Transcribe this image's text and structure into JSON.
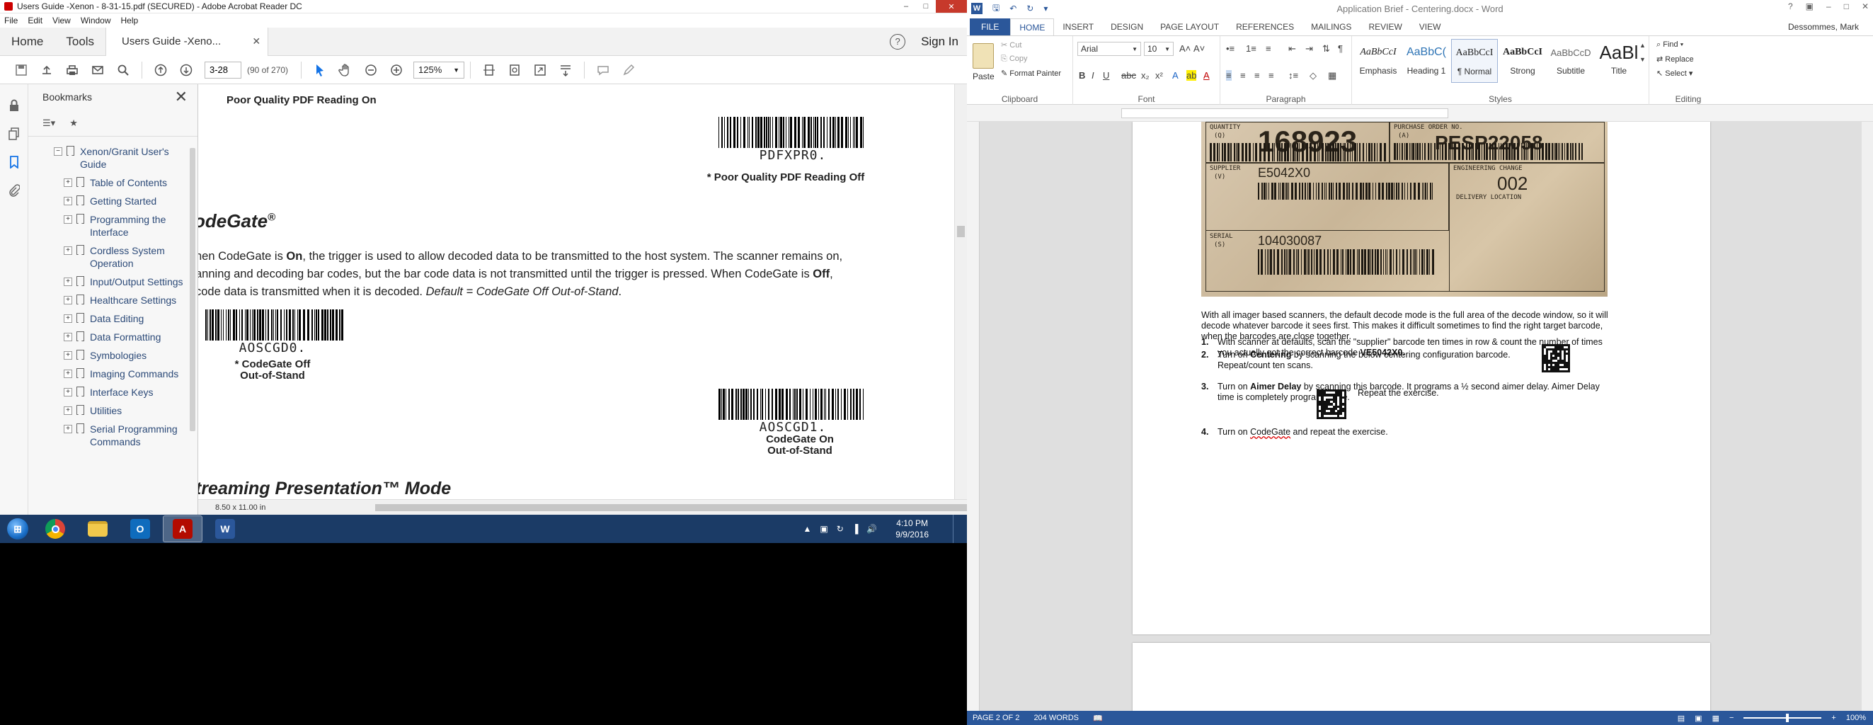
{
  "acrobat": {
    "title": "Users Guide -Xenon - 8-31-15.pdf (SECURED) - Adobe Acrobat Reader DC",
    "menu": [
      "File",
      "Edit",
      "View",
      "Window",
      "Help"
    ],
    "tabs": {
      "home": "Home",
      "tools": "Tools",
      "doc": "Users Guide -Xeno..."
    },
    "sign_in": "Sign In",
    "page_number": "3-28",
    "page_of": "(90 of 270)",
    "zoom": "125%",
    "bookmarks_title": "Bookmarks",
    "bookmarks": {
      "root": "Xenon/Granit User's Guide",
      "items": [
        "Table of Contents",
        "Getting Started",
        "Programming the Interface",
        "Cordless System Operation",
        "Input/Output Settings",
        "Healthcare Settings",
        "Data Editing",
        "Data Formatting",
        "Symbologies",
        "Imaging Commands",
        "Interface Keys",
        "Utilities",
        "Serial Programming Commands"
      ]
    },
    "page": {
      "heading_top": "Poor Quality PDF Reading On",
      "bc1_text": "PDFXPR0.",
      "bc1_label": "* Poor Quality PDF Reading Off",
      "section_title": "odeGate",
      "section_sup": "®",
      "para_line1_a": "hen CodeGate is ",
      "para_line1_b": "On",
      "para_line1_c": ", the trigger is used to allow decoded data to be transmitted to the host system.  The scanner remains on,",
      "para_line2": "anning and decoding bar codes, but the bar code data is not transmitted until the trigger is pressed.  When CodeGate is ",
      "para_line2_b": "Off",
      "para_line2_c": ",",
      "para_line3_a": " code data is transmitted when it is decoded.  ",
      "para_line3_b": "Default = CodeGate Off Out-of-Stand",
      "para_line3_c": ".",
      "bc2_text": "AOSCGD0.",
      "bc2_label_1": "* CodeGate Off",
      "bc2_label_2": "Out-of-Stand",
      "bc3_text": "AOSCGD1.",
      "bc3_label_1": "CodeGate On",
      "bc3_label_2": "Out-of-Stand",
      "section2_title": "treaming Presentation™ Mode"
    },
    "page_size": "8.50 x 11.00 in"
  },
  "taskbar": {
    "time": "4:10 PM",
    "date": "9/9/2016"
  },
  "word": {
    "title": "Application Brief - Centering.docx - Word",
    "user": "Dessommes, Mark",
    "tabs": [
      "FILE",
      "HOME",
      "INSERT",
      "DESIGN",
      "PAGE LAYOUT",
      "REFERENCES",
      "MAILINGS",
      "REVIEW",
      "VIEW"
    ],
    "clipboard": {
      "paste": "Paste",
      "cut": "Cut",
      "copy": "Copy",
      "format_painter": "Format Painter",
      "group": "Clipboard"
    },
    "font": {
      "name": "Arial",
      "size": "10",
      "group": "Font"
    },
    "paragraph_group": "Paragraph",
    "styles": [
      {
        "preview": "AaBbCcI",
        "name": "Emphasis"
      },
      {
        "preview": "AaBbC(",
        "name": "Heading 1"
      },
      {
        "preview": "AaBbCcI",
        "name": "¶ Normal"
      },
      {
        "preview": "AaBbCcI",
        "name": "Strong"
      },
      {
        "preview": "AaBbCcD",
        "name": "Subtitle"
      },
      {
        "preview": "AaBl",
        "name": "Title"
      }
    ],
    "styles_group": "Styles",
    "editing": {
      "find": "Find",
      "replace": "Replace",
      "select": "Select",
      "group": "Editing"
    },
    "label_photo": {
      "quantity_lbl": "QUANTITY",
      "quantity_q": "(Q)",
      "quantity": "168923",
      "po_lbl": "PURCHASE ORDER NO.",
      "po_a": "(A)",
      "po": "PESP22058",
      "supplier_lbl": "SUPPLIER",
      "supplier_v": "(V)",
      "supplier": "E5042X0",
      "eng_lbl": "ENGINEERING CHANGE",
      "eng": "002",
      "delivery_lbl": "DELIVERY LOCATION",
      "serial_lbl": "SERIAL",
      "serial_s": "(S)",
      "serial": "104030087"
    },
    "intro": "With all imager based scanners, the default decode mode is the full area of the decode window, so it will decode whatever barcode it sees first. This makes it difficult sometimes to find the right target barcode, when the barcodes are close together.",
    "steps": {
      "s1_num": "1.",
      "s1_a": "With scanner at defaults, scan the \"supplier\" barcode ten times in row & count the number of times you actually got the correct barcode ",
      "s1_b": "VE5042X0.",
      "s2_num": "2.",
      "s2_a": "Turn on ",
      "s2_b": "Centering",
      "s2_c": " by scanning the below centering configuration barcode.",
      "s2_d": "Repeat/count ten scans.",
      "s3_num": "3.",
      "s3_a": "Turn on ",
      "s3_b": "Aimer Delay",
      "s3_c": " by scanning this barcode.  It programs a ½ second aimer delay.  Aimer Delay time is completely programmable.",
      "s3_d": "Repeat the exercise.",
      "s4_num": "4.",
      "s4_a": "Turn on ",
      "s4_b": "CodeGate",
      "s4_c": " and repeat the exercise."
    },
    "status": {
      "page": "PAGE 2 OF 2",
      "words": "204 WORDS",
      "zoom": "100%"
    }
  }
}
